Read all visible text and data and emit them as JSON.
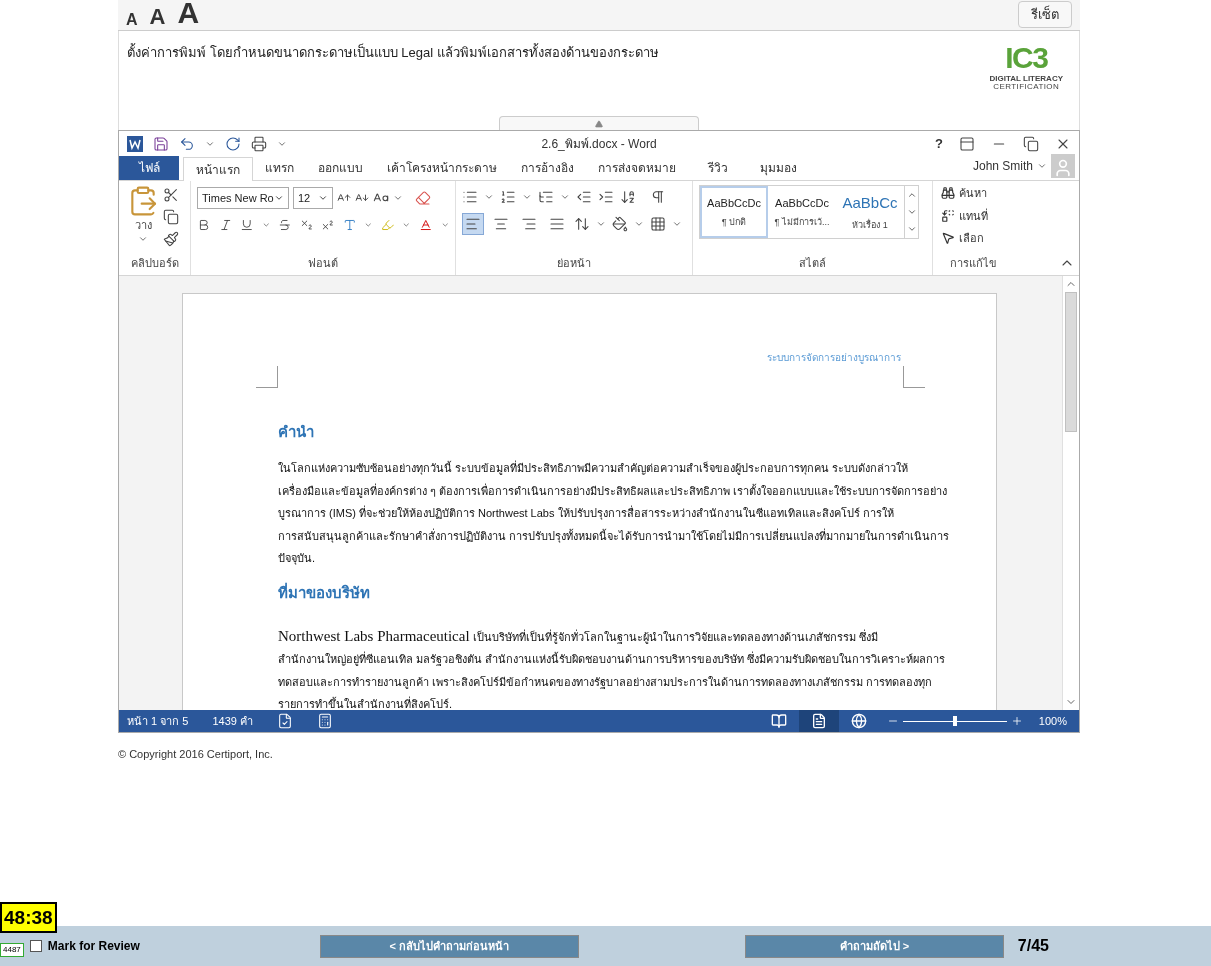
{
  "text_size_buttons": [
    "A",
    "A",
    "A"
  ],
  "reset_button": "รีเซ็ต",
  "task": "ตั้งค่าการพิมพ์ โดยกำหนดขนาดกระดาษเป็นแบบ Legal แล้วพิมพ์เอกสารทั้งสองด้านของกระดาษ",
  "logo": {
    "mark": "IC3",
    "line1": "DIGITAL LITERACY",
    "line2": "CERTIFICATION"
  },
  "word": {
    "title": "2.6_พิมพ์.docx - Word",
    "help": "?",
    "tabs": [
      {
        "label": "ไฟล์",
        "kind": "file",
        "selected": false
      },
      {
        "label": "หน้าแรก",
        "kind": "tab",
        "selected": true
      },
      {
        "label": "แทรก",
        "kind": "tab",
        "selected": false
      },
      {
        "label": "ออกแบบ",
        "kind": "tab",
        "selected": false
      },
      {
        "label": "เค้าโครงหน้ากระดาษ",
        "kind": "tab",
        "selected": false
      },
      {
        "label": "การอ้างอิง",
        "kind": "tab",
        "selected": false
      },
      {
        "label": "การส่งจดหมาย",
        "kind": "tab",
        "selected": false
      },
      {
        "label": "รีวิว",
        "kind": "tab",
        "selected": false
      },
      {
        "label": "มุมมอง",
        "kind": "tab",
        "selected": false
      }
    ],
    "user": "John Smith",
    "ribbon": {
      "paste_label": "วาง",
      "font_name": "Times New Ro",
      "font_size": "12",
      "align_buttons": [
        {
          "kind": "left",
          "selected": true
        },
        {
          "kind": "center",
          "selected": false
        },
        {
          "kind": "right",
          "selected": false
        },
        {
          "kind": "justify",
          "selected": false
        }
      ],
      "styles": [
        {
          "preview": "AaBbCcDc",
          "name": "¶ ปกติ",
          "kind": "normal",
          "selected": true
        },
        {
          "preview": "AaBbCcDc",
          "name": "¶ ไม่มีการเว้...",
          "kind": "normal",
          "selected": false
        },
        {
          "preview": "AaBbCc",
          "name": "หัวเรื่อง 1",
          "kind": "heading",
          "selected": false
        }
      ],
      "editing": [
        {
          "label": "ค้นหา",
          "kind": "find"
        },
        {
          "label": "แทนที่",
          "kind": "replace"
        },
        {
          "label": "เลือก",
          "kind": "select"
        }
      ],
      "groups": [
        "คลิปบอร์ด",
        "ฟอนต์",
        "ย่อหน้า",
        "สไตล์",
        "การแก้ไข"
      ]
    },
    "document": {
      "header": "ระบบการจัดการอย่างบูรณาการ",
      "sections": [
        {
          "heading": "คำนำ",
          "paragraphs": [
            {
              "kind": "body",
              "lines": [
                "ในโลกแห่งความซับซ้อนอย่างทุกวันนี้ ระบบข้อมูลที่มีประสิทธิภาพมีความสำคัญต่อความสำเร็จของผู้ประกอบการทุกคน ระบบดังกล่าวให้",
                "เครื่องมือและข้อมูลที่องค์กรต่าง ๆ ต้องการเพื่อการดำเนินการอย่างมีประสิทธิผลและประสิทธิภาพ เราตั้งใจออกแบบและใช้ระบบการจัดการอย่าง",
                "บูรณาการ (IMS) ที่จะช่วยให้ห้องปฏิบัติการ Northwest Labs ให้ปรับปรุงการสื่อสารระหว่างสำนักงานในซีแอทเทิลและสิงคโปร์ การให้",
                "การสนับสนุนลูกค้าและรักษาคำสั่งการปฏิบัติงาน การปรับปรุงทั้งหมดนี้จะได้รับการนำมาใช้โดยไม่มีการเปลี่ยนแปลงที่มากมายในการดำเนินการ",
                "ปัจจุบัน."
              ]
            }
          ]
        },
        {
          "heading": "ที่มาของบริษัท",
          "paragraphs": [
            {
              "kind": "lead",
              "lead": "Northwest Labs Pharmaceutical",
              "lines": [
                "เป็นบริษัทที่เป็นที่รู้จักทั่วโลกในฐานะผู้นำในการวิจัยและทดลองทางด้านเภสัชกรรม ซึ่งมี"
              ]
            },
            {
              "kind": "body",
              "lines": [
                "สำนักงานใหญ่อยู่ที่ซีแอนเทิล มลรัฐวอชิงตัน สำนักงานแห่งนี้รับผิดชอบงานด้านการบริหารของบริษัท ซึ่งมีความรับผิดชอบในการวิเคราะห์ผลการ",
                "ทดสอบและการทำรายงานลูกค้า เพราะสิงคโปร์มีข้อกำหนดของทางรัฐบาลอย่างสามประการในด้านการทดลองทางเภสัชกรรม การทดลองทุก",
                "รายการทำขึ้นในสำนักงานที่สิงคโปร์."
              ]
            }
          ]
        }
      ]
    },
    "status": {
      "page": "หน้า 1 จาก 5",
      "words": "1439 คำ",
      "views": [
        {
          "kind": "read",
          "selected": false
        },
        {
          "kind": "print",
          "selected": true
        },
        {
          "kind": "web",
          "selected": false
        }
      ],
      "zoom": {
        "level": 0.5
      },
      "zoom_reading": "100%"
    }
  },
  "copyright": "© Copyright 2016 Certiport, Inc.",
  "timer": "48:38",
  "counter": "4487",
  "mark_review": {
    "label": "Mark for Review",
    "checked": false
  },
  "prev_button": "< กลับไปคำถามก่อนหน้า",
  "next_button": "คำถามถัดไป >",
  "progress": "7/45"
}
